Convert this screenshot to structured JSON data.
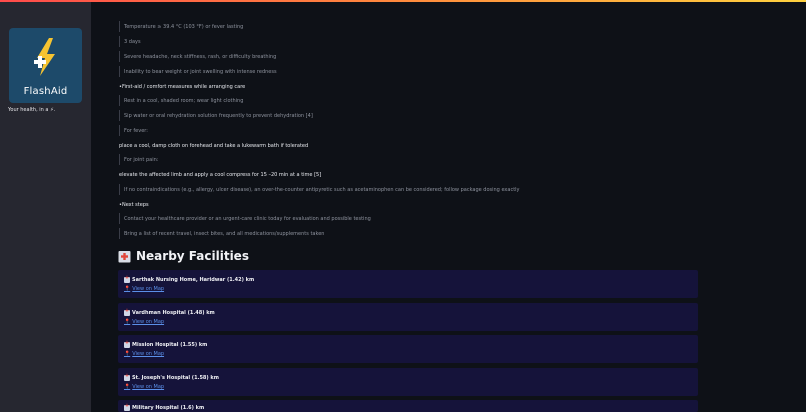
{
  "sidebar": {
    "logo_text": "FlashAid",
    "tagline": "Your health, in a ⚡."
  },
  "content": {
    "lines": [
      "Temperature ≥ 39.4 °C (103 °F) or fever lasting",
      "3 days",
      "Severe headache, neck stiffness, rash, or difficulty breathing",
      "Inability to bear weight or joint swelling with intense redness",
      "•First-aid / comfort measures while arranging care",
      "Rest in a cool, shaded room; wear light clothing",
      "Sip water or oral rehydration solution frequently to prevent dehydration [4]",
      "For fever:",
      "place a cool, damp cloth on forehead and take a lukewarm bath if tolerated",
      "For joint pain:",
      "elevate the affected limb and apply a cool compress for 15 –20 min at a time [5]",
      "If no contraindications (e.g., allergy, ulcer disease), an over-the-counter antipyretic such as acetaminophen can be considered; follow package dosing exactly",
      "•Next steps",
      "Contact your healthcare provider or an urgent-care clinic today for evaluation and possible testing",
      "Bring a list of recent travel, insect bites, and all medications/supplements taken"
    ],
    "section_title": "Nearby Facilities",
    "facilities": [
      {
        "name": "Sarthak Nursing Home, Haridwar (1.42) km",
        "link": "View on Map"
      },
      {
        "name": "Vardhman Hospital (1.48) km",
        "link": "View on Map"
      },
      {
        "name": "Mission Hospital (1.55) km",
        "link": "View on Map"
      },
      {
        "name": "St. Joseph's Hospital (1.58) km",
        "link": "View on Map"
      },
      {
        "name": "Military Hospital (1.6) km",
        "link": ""
      }
    ]
  },
  "colors": {
    "background": "#0e1117",
    "sidebar": "#262730",
    "card": "#15133a",
    "link": "#5b8fe8",
    "logo_bolt": "#f6c431"
  }
}
